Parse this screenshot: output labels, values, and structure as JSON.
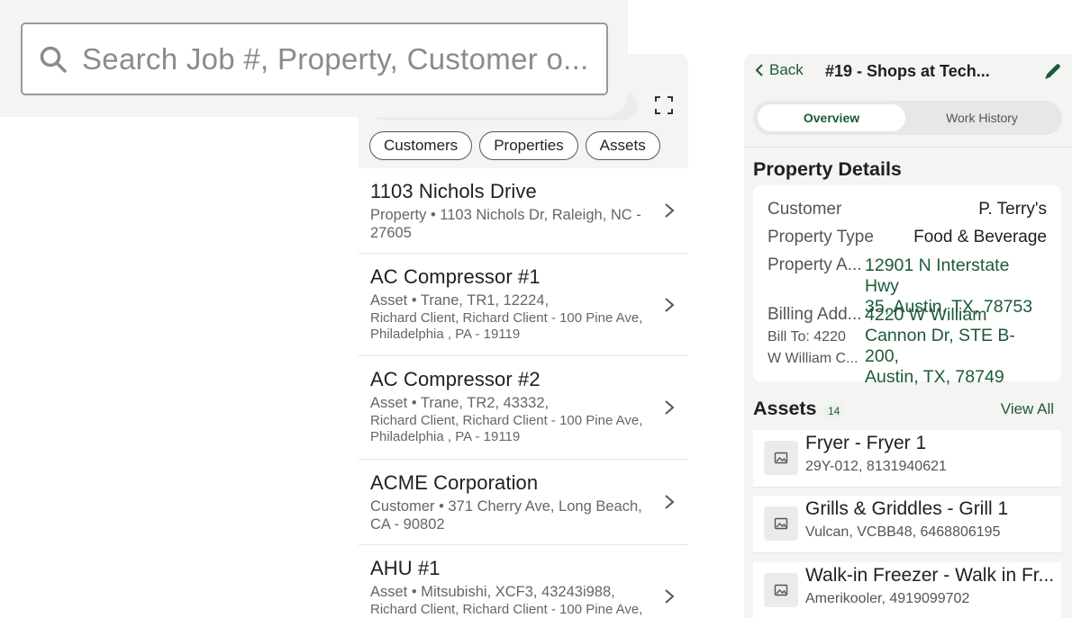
{
  "search": {
    "placeholder": "Search Job #, Property, Customer o..."
  },
  "filters": [
    "Customers",
    "Properties",
    "Assets"
  ],
  "results": [
    {
      "title": "1103 Nichols Drive",
      "subtitle": "Property • 1103 Nichols Dr, Raleigh, NC - 27605",
      "detail": ""
    },
    {
      "title": "AC Compressor #1",
      "subtitle": "Asset • Trane, TR1, 12224,",
      "detail": "Richard Client, Richard Client - 100 Pine Ave, Philadelphia , PA - 19119"
    },
    {
      "title": "AC Compressor #2",
      "subtitle": "Asset • Trane, TR2, 43332,",
      "detail": "Richard Client, Richard Client - 100 Pine Ave, Philadelphia , PA - 19119"
    },
    {
      "title": "ACME Corporation",
      "subtitle": "Customer • 371 Cherry Ave, Long Beach, CA - 90802",
      "detail": ""
    },
    {
      "title": "AHU #1",
      "subtitle": "Asset • Mitsubishi, XCF3, 43243i988,",
      "detail": "Richard Client, Richard Client - 100 Pine Ave,"
    }
  ],
  "detail": {
    "back_label": "Back",
    "title": "#19 - Shops at Tech...",
    "tabs": {
      "overview": "Overview",
      "history": "Work History"
    },
    "section_title": "Property Details",
    "customer_label": "Customer",
    "customer_value": "P. Terry's",
    "type_label": "Property Type",
    "type_value": "Food & Beverage",
    "address_label": "Property A...",
    "address_line1": "12901 N Interstate Hwy",
    "address_line2": "35, Austin, TX, 78753",
    "billing_label": "Billing Add...",
    "billing_sub1": "Bill To: 4220",
    "billing_sub2": "W William C...",
    "billing_line1": "4220 W William",
    "billing_line2": "Cannon Dr, STE B-200,",
    "billing_line3": "Austin, TX, 78749",
    "assets_title": "Assets",
    "assets_count": "14",
    "view_all": "View All",
    "assets": [
      {
        "name": "Fryer - Fryer 1",
        "desc": "29Y-012, 8131940621"
      },
      {
        "name": "Grills & Griddles - Grill 1",
        "desc": "Vulcan, VCBB48, 6468806195"
      },
      {
        "name": "Walk-in Freezer - Walk in Fr...",
        "desc": "Amerikooler, 4919099702"
      }
    ]
  },
  "colors": {
    "accent": "#1e5a36",
    "panel_bg": "#f4f4f2"
  }
}
